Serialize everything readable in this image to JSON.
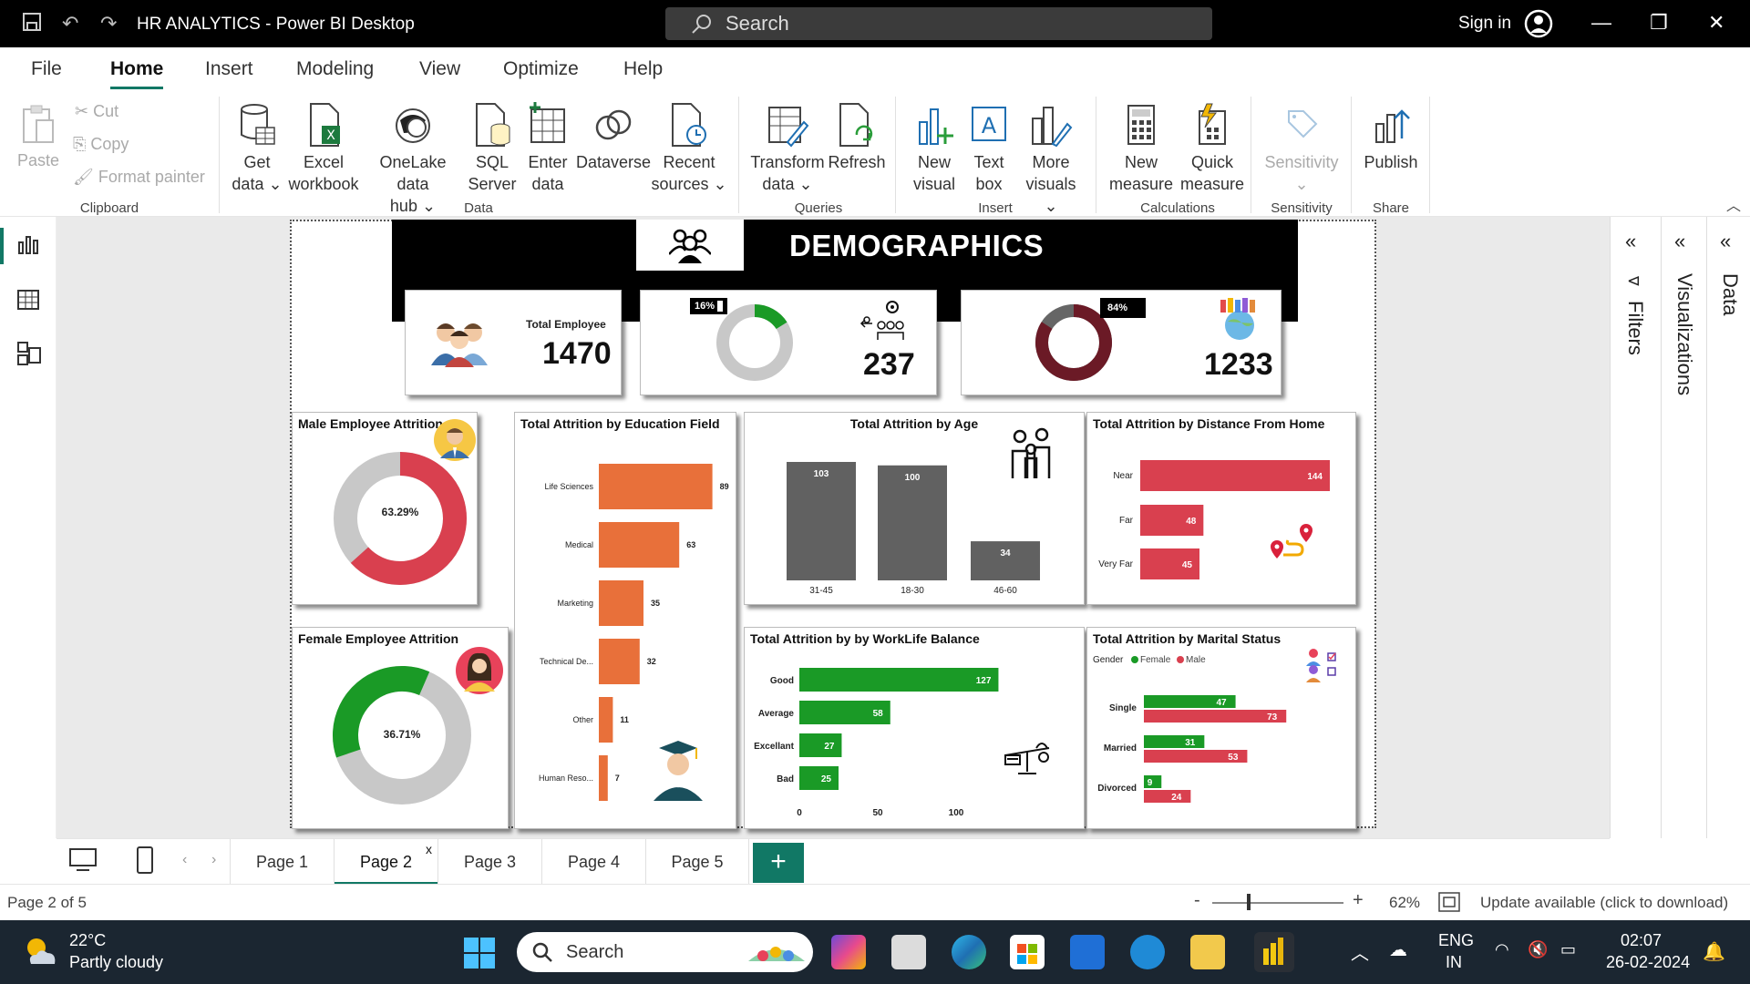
{
  "titlebar": {
    "title": "HR ANALYTICS - Power BI Desktop",
    "search_placeholder": "Search",
    "sign_in": "Sign in"
  },
  "menu": {
    "tabs": [
      "File",
      "Home",
      "Insert",
      "Modeling",
      "View",
      "Optimize",
      "Help"
    ],
    "active": "Home"
  },
  "ribbon": {
    "clipboard": {
      "paste": "Paste",
      "cut": "Cut",
      "copy": "Copy",
      "format_painter": "Format painter",
      "group": "Clipboard"
    },
    "data": {
      "get_data": [
        "Get",
        "data"
      ],
      "excel": [
        "Excel",
        "workbook"
      ],
      "onelake": [
        "OneLake data",
        "hub"
      ],
      "sql": [
        "SQL",
        "Server"
      ],
      "enter": [
        "Enter",
        "data"
      ],
      "dataverse": "Dataverse",
      "recent": [
        "Recent",
        "sources"
      ],
      "group": "Data"
    },
    "queries": {
      "transform": [
        "Transform",
        "data"
      ],
      "refresh": "Refresh",
      "group": "Queries"
    },
    "insert": {
      "new_visual": [
        "New",
        "visual"
      ],
      "text_box": [
        "Text",
        "box"
      ],
      "more_visuals": [
        "More",
        "visuals"
      ],
      "group": "Insert"
    },
    "calculations": {
      "new_measure": [
        "New",
        "measure"
      ],
      "quick_measure": [
        "Quick",
        "measure"
      ],
      "group": "Calculations"
    },
    "sensitivity": {
      "label": "Sensitivity",
      "group": "Sensitivity"
    },
    "share": {
      "publish": "Publish",
      "group": "Share"
    }
  },
  "panes": {
    "filters": "Filters",
    "visualizations": "Visualizations",
    "data": "Data"
  },
  "report": {
    "header_title": "DEMOGRAPHICS",
    "kpi_total_employee_label": "Total Employee",
    "kpi_total_employee_value": "1470",
    "kpi_attrition_pct": "16%",
    "kpi_attrition_value": "237",
    "kpi_retained_pct": "84%",
    "kpi_retained_value": "1233",
    "male_title": "Male Employee Attrition",
    "male_pct": "63.29%",
    "female_title": "Female Employee Attrition",
    "female_pct": "36.71%"
  },
  "chart_data": [
    {
      "type": "bar",
      "title": "Total Attrition by Education Field",
      "orientation": "horizontal",
      "categories": [
        "Life Sciences",
        "Medical",
        "Marketing",
        "Technical De...",
        "Other",
        "Human Reso..."
      ],
      "values": [
        89,
        63,
        35,
        32,
        11,
        7
      ],
      "color": "#e8703a"
    },
    {
      "type": "bar",
      "title": "Total Attrition by Age",
      "orientation": "vertical",
      "categories": [
        "31-45",
        "18-30",
        "46-60"
      ],
      "values": [
        103,
        100,
        34
      ],
      "color": "#616161"
    },
    {
      "type": "bar",
      "title": "Total Attrition by Distance From Home",
      "orientation": "horizontal",
      "categories": [
        "Near",
        "Far",
        "Very Far"
      ],
      "values": [
        144,
        48,
        45
      ],
      "color": "#d9404f"
    },
    {
      "type": "bar",
      "title": "Total Attrition by by WorkLife Balance",
      "orientation": "horizontal",
      "categories": [
        "Good",
        "Average",
        "Excellant",
        "Bad"
      ],
      "values": [
        127,
        58,
        27,
        25
      ],
      "xticks": [
        "0",
        "50",
        "100"
      ],
      "color": "#1a9a26"
    },
    {
      "type": "bar",
      "title": "Total Attrition by Marital Status",
      "orientation": "horizontal",
      "legend_title": "Gender",
      "categories": [
        "Single",
        "Married",
        "Divorced"
      ],
      "series": [
        {
          "name": "Female",
          "values": [
            47,
            31,
            9
          ],
          "color": "#1a9a26"
        },
        {
          "name": "Male",
          "values": [
            73,
            53,
            24
          ],
          "color": "#d9404f"
        }
      ]
    }
  ],
  "pages": {
    "tabs": [
      "Page 1",
      "Page 2",
      "Page 3",
      "Page 4",
      "Page 5"
    ],
    "active": "Page 2",
    "close_glyph": "x",
    "add": "+"
  },
  "status": {
    "page_indicator": "Page 2 of 5",
    "zoom": "62%",
    "zoom_minus": "-",
    "zoom_plus": "+",
    "update": "Update available (click to download)"
  },
  "taskbar": {
    "temp": "22°C",
    "weather": "Partly cloudy",
    "search": "Search",
    "lang1": "ENG",
    "lang2": "IN",
    "time": "02:07",
    "date": "26-02-2024"
  }
}
